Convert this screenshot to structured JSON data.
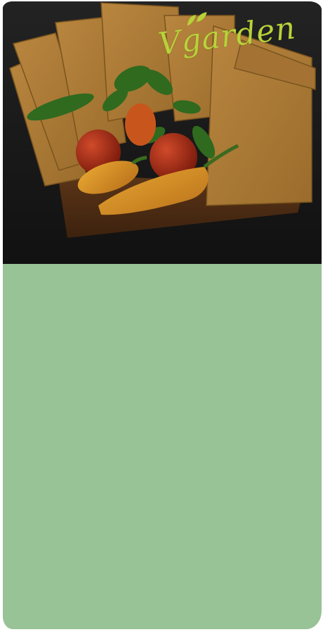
{
  "brand": {
    "logo_text": "Vgarden",
    "logo_color": "#b8d23a",
    "logo_icon": "leaf-icon"
  },
  "hero": {
    "image": "cheese-slices-with-vegetables"
  },
  "panel": {
    "background_color": "#97c397"
  }
}
